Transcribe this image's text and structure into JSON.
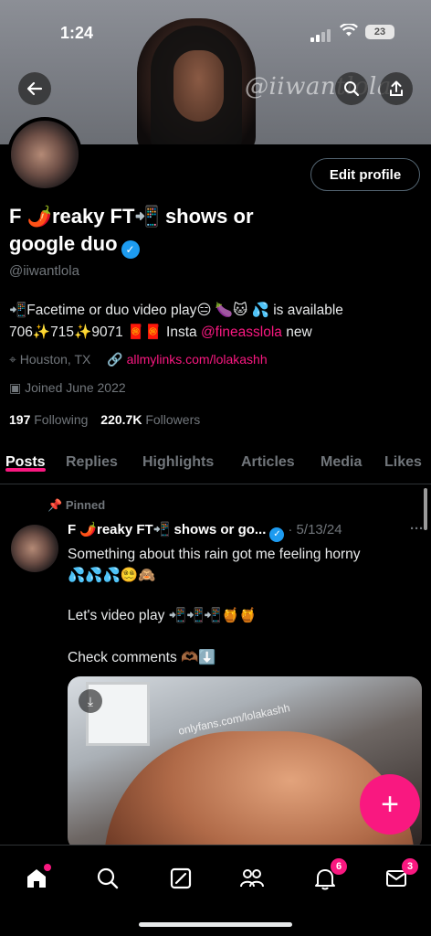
{
  "status": {
    "time": "1:24",
    "battery": "23"
  },
  "banner": {
    "watermark": "@iiwantlola"
  },
  "profile": {
    "edit_label": "Edit profile",
    "display_name_line1": "F 🌶️reaky FT📲 shows or",
    "display_name_line2": "google duo",
    "handle": "@iiwantlola",
    "bio_part1": "📲Facetime or duo video play😑 🍆🐱 💦 is available",
    "bio_part2": "706✨715✨9071 🧧🧧 Insta",
    "bio_mention": "@fineasslola",
    "bio_part3": "new",
    "location": "Houston, TX",
    "link": "allmylinks.com/lolakashh",
    "joined": "Joined June 2022",
    "following_count": "197",
    "following_label": "Following",
    "followers_count": "220.7K",
    "followers_label": "Followers"
  },
  "tabs": [
    "Posts",
    "Replies",
    "Highlights",
    "Articles",
    "Media",
    "Likes"
  ],
  "post": {
    "pinned_label": "Pinned",
    "author": "F 🌶️reaky FT📲 shows or go...",
    "date": "· 5/13/24",
    "more": "···",
    "text1": "Something about this rain got me feeling horny",
    "text1b": "💦💦💦😵‍💫🙈",
    "text2": "Let's video play 📲📲📲🍯🍯",
    "text3": "Check comments 🫶🏾⬇️",
    "media_watermark": "onlyfans.com/lolakashh"
  },
  "nav": {
    "notifications_badge": "6",
    "messages_badge": "3"
  },
  "colors": {
    "accent": "#f91880",
    "verified": "#1d9bf0",
    "muted": "#71767b"
  }
}
